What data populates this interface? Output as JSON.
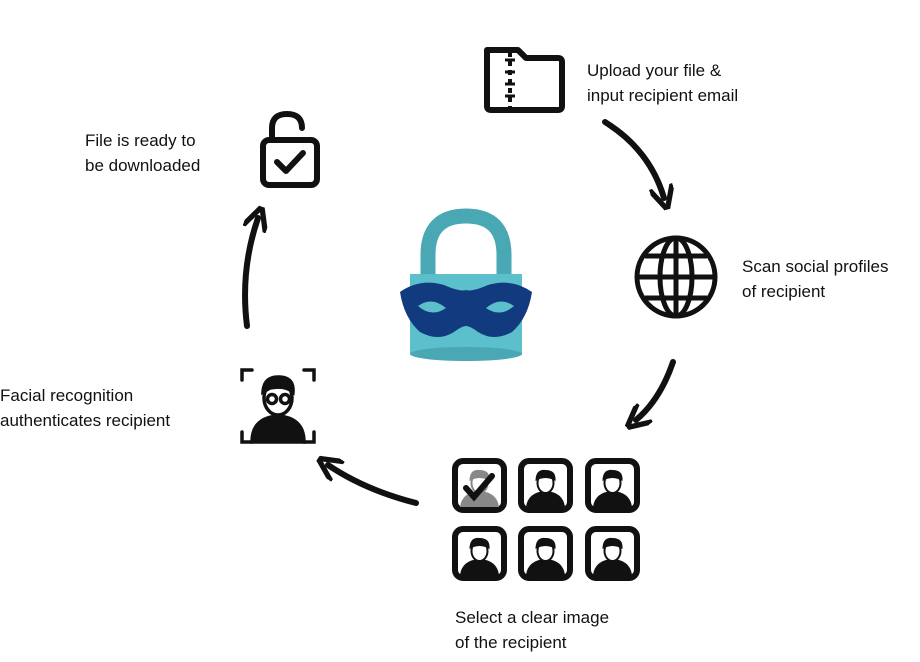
{
  "steps": [
    {
      "label_line1": "Upload your file &",
      "label_line2": "input recipient email",
      "icon": "folder-zip-icon"
    },
    {
      "label_line1": "Scan social profiles",
      "label_line2": "of recipient",
      "icon": "globe-icon"
    },
    {
      "label_line1": "Select a clear image",
      "label_line2": "of the recipient",
      "icon": "profile-photo-grid-icon"
    },
    {
      "label_line1": "Facial recognition",
      "label_line2": "authenticates recipient",
      "icon": "face-scan-icon"
    },
    {
      "label_line1": "File is ready to",
      "label_line2": "be downloaded",
      "icon": "unlocked-padlock-check-icon"
    }
  ],
  "center_icon": "padlock-mask-icon",
  "colors": {
    "lock_light": "#5bbfcc",
    "lock_dark": "#4aa7b4",
    "mask": "#123a7e",
    "ink": "#111111",
    "selected_tile": "#888888"
  }
}
